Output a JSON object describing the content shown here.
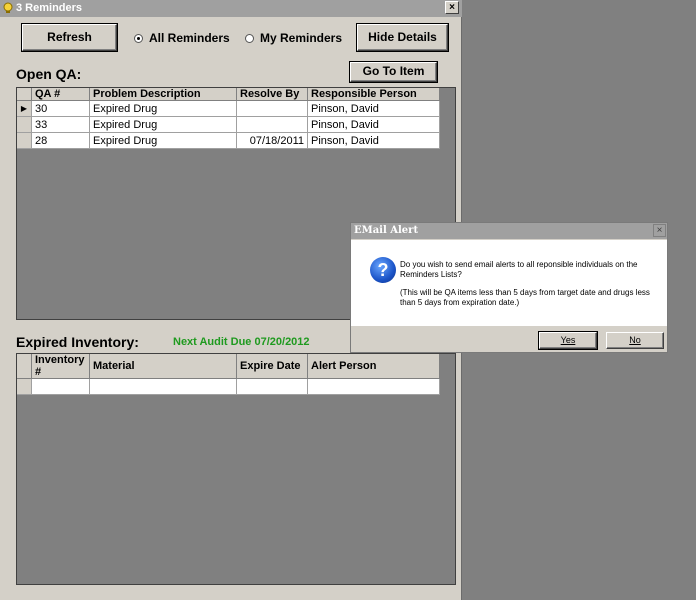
{
  "window": {
    "title": "3 Reminders",
    "close_glyph": "×"
  },
  "toolbar": {
    "refresh_label": "Refresh",
    "all_reminders_label": "All Reminders",
    "my_reminders_label": "My Reminders",
    "hide_details_label": "Hide Details",
    "selected_filter": "All Reminders"
  },
  "open_qa": {
    "title": "Open QA:",
    "go_to_item_label": "Go To Item",
    "columns": [
      "QA #",
      "Problem Description",
      "Resolve By",
      "Responsible Person"
    ],
    "rows": [
      {
        "qa": "30",
        "problem": "Expired Drug",
        "resolve_by": "",
        "person": "Pinson, David",
        "current": true
      },
      {
        "qa": "33",
        "problem": "Expired Drug",
        "resolve_by": "",
        "person": "Pinson, David",
        "current": false
      },
      {
        "qa": "28",
        "problem": "Expired Drug",
        "resolve_by": "07/18/2011",
        "person": "Pinson, David",
        "current": false
      }
    ]
  },
  "expired_inventory": {
    "title": "Expired Inventory:",
    "audit_note": "Next Audit Due 07/20/2012",
    "columns": [
      "Inventory #",
      "Material",
      "Expire Date",
      "Alert Person"
    ]
  },
  "dialog": {
    "title": "EMail Alert",
    "close_glyph": "×",
    "icon": "question-icon",
    "message": "Do you wish to send email alerts to all reponsible individuals on the Reminders Lists?",
    "note": "(This will be QA items less than 5 days from target date and drugs less than 5 days from expiration date.)",
    "yes_label": "Yes",
    "no_label": "No"
  },
  "colors": {
    "audit_note": "#1f9a1f",
    "desktop": "#808080",
    "window": "#d4d0c8"
  }
}
